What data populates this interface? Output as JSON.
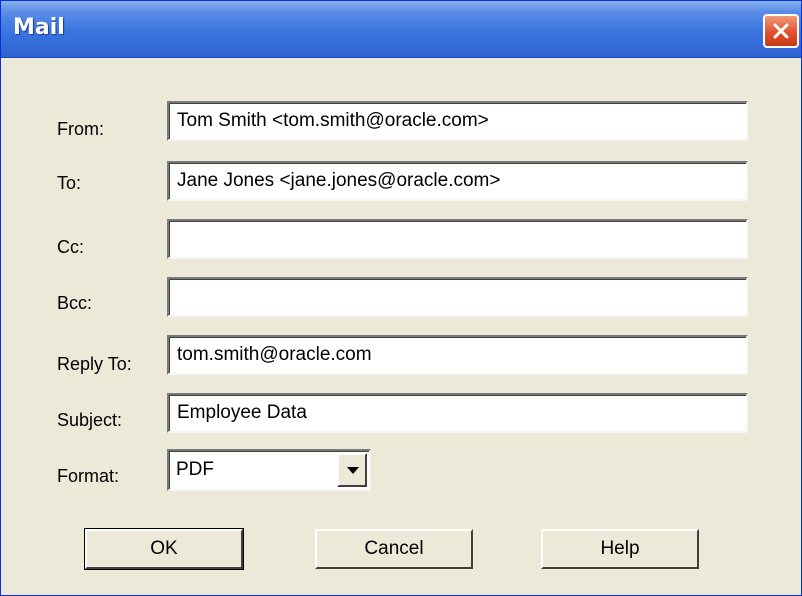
{
  "window": {
    "title": "Mail"
  },
  "fields": {
    "from": {
      "label": "From:",
      "value": "Tom Smith <tom.smith@oracle.com>"
    },
    "to": {
      "label": "To:",
      "value": "Jane Jones <jane.jones@oracle.com>"
    },
    "cc": {
      "label": "Cc:",
      "value": ""
    },
    "bcc": {
      "label": "Bcc:",
      "value": ""
    },
    "reply_to": {
      "label": "Reply To:",
      "value": "tom.smith@oracle.com"
    },
    "subject": {
      "label": "Subject:",
      "value": "Employee Data"
    },
    "format": {
      "label": "Format:",
      "value": "PDF"
    }
  },
  "buttons": {
    "ok": "OK",
    "cancel": "Cancel",
    "help": "Help"
  },
  "icons": {
    "close": "close-icon",
    "dropdown": "chevron-down-icon"
  },
  "colors": {
    "title_bar": "#3a74e0",
    "close_button": "#e2512b",
    "dialog_bg": "#ece9d8"
  }
}
